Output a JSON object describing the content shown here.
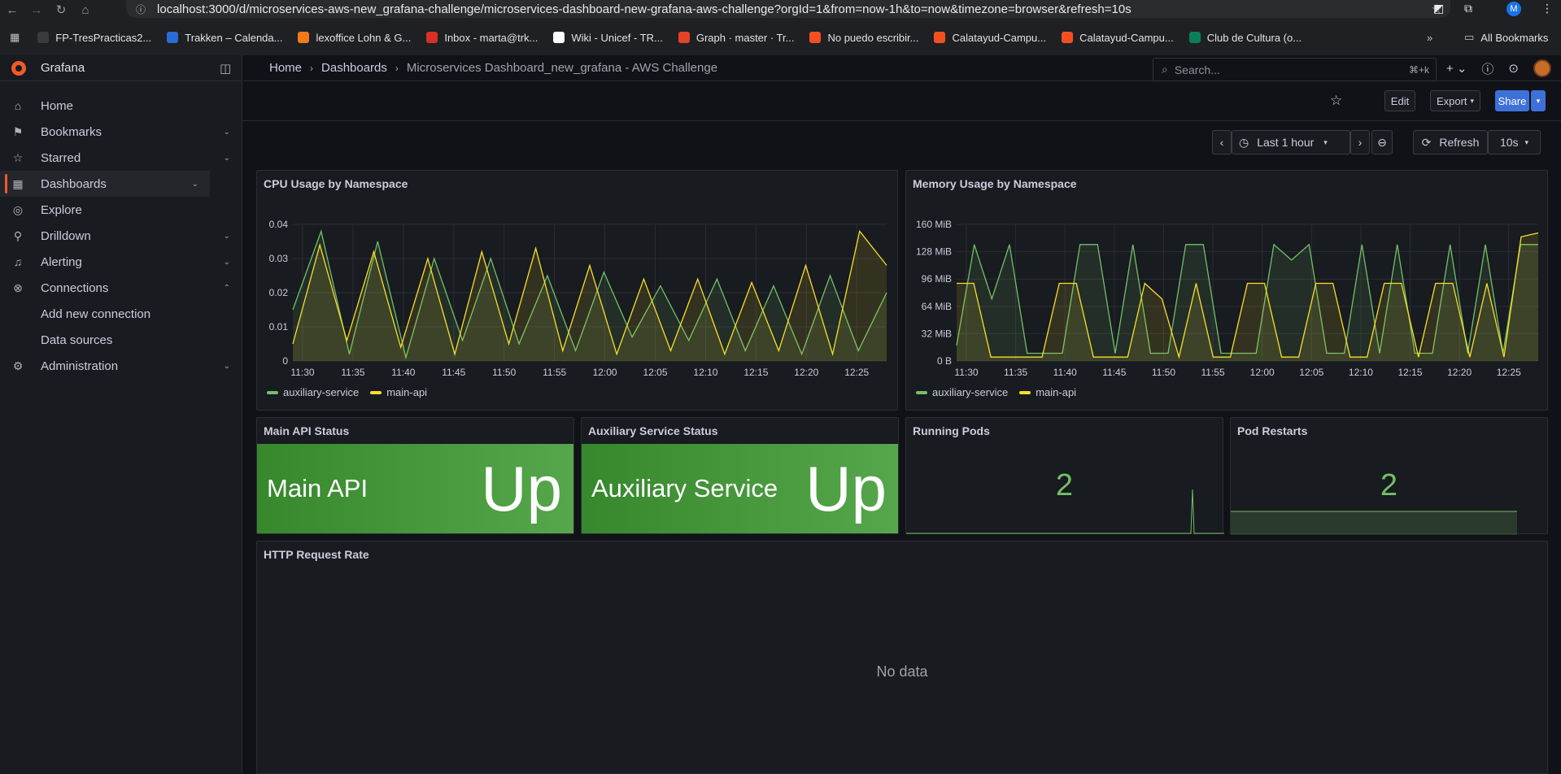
{
  "browser": {
    "url": "localhost:3000/d/microservices-aws-new_grafana-challenge/microservices-dashboard-new-grafana-aws-challenge?orgId=1&from=now-1h&to=now&timezone=browser&refresh=10s",
    "profile_initial": "M",
    "bookmarks": [
      {
        "label": "FP-TresPracticas2...",
        "color": "#3b3b3b"
      },
      {
        "label": "Trakken – Calenda...",
        "color": "#2a6bd6"
      },
      {
        "label": "lexoffice Lohn & G...",
        "color": "#f07a1a"
      },
      {
        "label": "Inbox - marta@trk...",
        "color": "#d93025"
      },
      {
        "label": "Wiki - Unicef - TR...",
        "color": "#ffffff"
      },
      {
        "label": "Graph · master · Tr...",
        "color": "#e24329"
      },
      {
        "label": "No puedo escribir...",
        "color": "#f25022"
      },
      {
        "label": "Calatayud-Campu...",
        "color": "#f25022"
      },
      {
        "label": "Calatayud-Campu...",
        "color": "#f25022"
      },
      {
        "label": "Club de Cultura (o...",
        "color": "#0a7e5c"
      }
    ],
    "all_bookmarks": "All Bookmarks"
  },
  "sidebar": {
    "brand": "Grafana",
    "items": [
      {
        "label": "Home",
        "icon": "home-icon",
        "chev": ""
      },
      {
        "label": "Bookmarks",
        "icon": "bookmark-icon",
        "chev": "⌄"
      },
      {
        "label": "Starred",
        "icon": "star-icon",
        "chev": "⌄"
      },
      {
        "label": "Dashboards",
        "icon": "dashboards-icon",
        "chev": "⌄"
      },
      {
        "label": "Explore",
        "icon": "compass-icon",
        "chev": ""
      },
      {
        "label": "Drilldown",
        "icon": "drilldown-icon",
        "chev": "⌄"
      },
      {
        "label": "Alerting",
        "icon": "bell-icon",
        "chev": "⌄"
      },
      {
        "label": "Connections",
        "icon": "connections-icon",
        "chev": "⌃"
      },
      {
        "label": "Add new connection",
        "icon": "",
        "chev": ""
      },
      {
        "label": "Data sources",
        "icon": "",
        "chev": ""
      },
      {
        "label": "Administration",
        "icon": "gear-icon",
        "chev": "⌄"
      }
    ]
  },
  "topbar": {
    "crumbs": [
      "Home",
      "Dashboards",
      "Microservices Dashboard_new_grafana - AWS Challenge"
    ],
    "search_placeholder": "Search...",
    "search_kbd": "⌘+k"
  },
  "toolbar": {
    "edit": "Edit",
    "export": "Export",
    "share": "Share"
  },
  "timepicker": {
    "range": "Last 1 hour",
    "refresh": "Refresh",
    "interval": "10s"
  },
  "panels": {
    "cpu": {
      "title": "CPU Usage by Namespace"
    },
    "mem": {
      "title": "Memory Usage by Namespace"
    },
    "main_api": {
      "title": "Main API Status",
      "name": "Main API",
      "value": "Up"
    },
    "aux": {
      "title": "Auxiliary Service Status",
      "name": "Auxiliary Service",
      "value": "Up"
    },
    "pods": {
      "title": "Running Pods",
      "value": "2"
    },
    "restarts": {
      "title": "Pod Restarts",
      "value": "2"
    },
    "http": {
      "title": "HTTP Request Rate",
      "nodata": "No data"
    }
  },
  "colors": {
    "green": "#73bf69",
    "yellow": "#fade2a",
    "accent": "#f05a28"
  },
  "chart_data": [
    {
      "type": "line",
      "title": "CPU Usage by Namespace",
      "x": [
        "11:30",
        "11:35",
        "11:40",
        "11:45",
        "11:50",
        "11:55",
        "12:00",
        "12:05",
        "12:10",
        "12:15",
        "12:20",
        "12:25"
      ],
      "ylim": [
        0,
        0.04
      ],
      "yticks": [
        "0",
        "0.01",
        "0.02",
        "0.03",
        "0.04"
      ],
      "series": [
        {
          "name": "auxiliary-service",
          "color": "#73bf69",
          "values": [
            0.015,
            0.038,
            0.002,
            0.035,
            0.001,
            0.03,
            0.006,
            0.03,
            0.005,
            0.025,
            0.003,
            0.026,
            0.007,
            0.022,
            0.006,
            0.024,
            0.003,
            0.022,
            0.002,
            0.025,
            0.003,
            0.02
          ]
        },
        {
          "name": "main-api",
          "color": "#fade2a",
          "values": [
            0.005,
            0.034,
            0.006,
            0.032,
            0.004,
            0.03,
            0.002,
            0.032,
            0.005,
            0.033,
            0.003,
            0.028,
            0.002,
            0.024,
            0.003,
            0.024,
            0.002,
            0.023,
            0.003,
            0.028,
            0.002,
            0.038,
            0.028
          ]
        }
      ]
    },
    {
      "type": "line",
      "title": "Memory Usage by Namespace",
      "x": [
        "11:30",
        "11:35",
        "11:40",
        "11:45",
        "11:50",
        "11:55",
        "12:00",
        "12:05",
        "12:10",
        "12:15",
        "12:20",
        "12:25"
      ],
      "ylim": [
        0,
        176
      ],
      "yticks": [
        "0 B",
        "32 MiB",
        "64 MiB",
        "96 MiB",
        "128 MiB",
        "160 MiB"
      ],
      "series": [
        {
          "name": "auxiliary-service",
          "color": "#73bf69",
          "values": [
            20,
            150,
            80,
            150,
            10,
            10,
            10,
            150,
            150,
            10,
            150,
            10,
            10,
            150,
            150,
            10,
            10,
            10,
            150,
            130,
            150,
            10,
            10,
            150,
            10,
            150,
            10,
            10,
            150,
            10,
            150,
            10,
            150,
            150
          ]
        },
        {
          "name": "main-api",
          "color": "#fade2a",
          "values": [
            100,
            100,
            5,
            5,
            5,
            5,
            100,
            100,
            5,
            5,
            5,
            100,
            80,
            5,
            100,
            5,
            5,
            100,
            100,
            5,
            5,
            100,
            100,
            5,
            5,
            100,
            100,
            5,
            100,
            100,
            5,
            100,
            5,
            160,
            165
          ]
        }
      ]
    }
  ]
}
